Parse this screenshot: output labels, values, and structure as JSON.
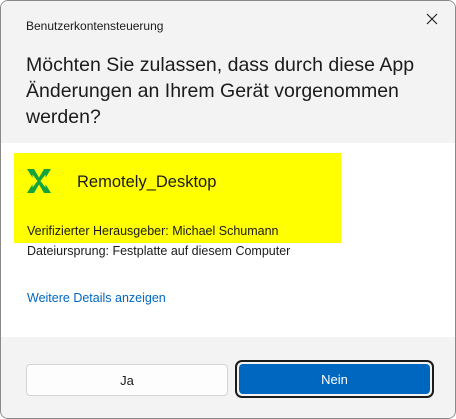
{
  "window": {
    "title": "Benutzerkontensteuerung",
    "close_icon": "close-icon"
  },
  "prompt": {
    "question": "Möchten Sie zulassen, dass durch diese App Änderungen an Ihrem Gerät vorgenommen werden?"
  },
  "app": {
    "name": "Remotely_Desktop",
    "icon": "app-icon",
    "publisher_line": "Verifizierter Herausgeber: Michael Schumann",
    "origin_line": "Dateiursprung: Festplatte auf diesem Computer",
    "highlight_color": "#ffff00",
    "icon_color": "#15a33b"
  },
  "details_link": "Weitere Details anzeigen",
  "buttons": {
    "yes": "Ja",
    "no": "Nein",
    "accent": "#0067c0"
  }
}
